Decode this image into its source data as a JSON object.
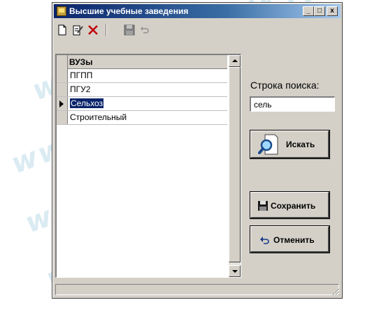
{
  "window": {
    "title": "Высшие учебные заведения",
    "controls": {
      "minimize": "_",
      "maximize": "□",
      "close": "x"
    }
  },
  "toolbar": {
    "icons": [
      "new-document-icon",
      "edit-document-icon",
      "delete-icon",
      "save-icon",
      "undo-icon"
    ]
  },
  "grid": {
    "column_header": "ВУЗы",
    "rows": [
      {
        "value": "ПГПП"
      },
      {
        "value": "ПГУ2"
      },
      {
        "value": "Сельхоз"
      },
      {
        "value": "Строительный"
      }
    ],
    "selected_index": 2
  },
  "search": {
    "label": "Строка поиска:",
    "value": "сель",
    "search_button": "Искать"
  },
  "actions": {
    "save_button": "Сохранить",
    "cancel_button": "Отменить"
  },
  "watermark": "www.diplom-it.ru"
}
